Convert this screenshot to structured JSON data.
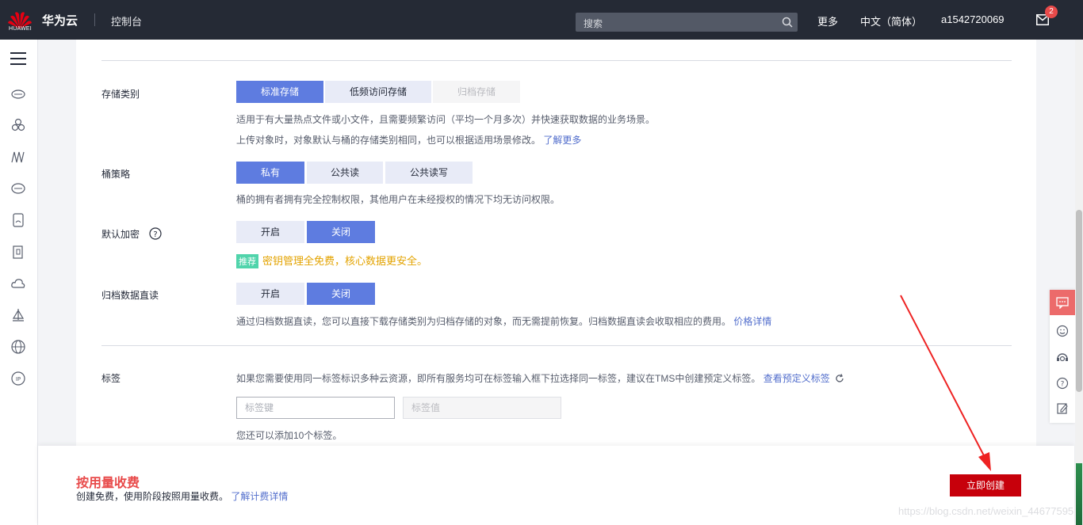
{
  "topbar": {
    "logo_text": "HUAWEI",
    "brand": "华为云",
    "console": "控制台",
    "search_placeholder": "搜索",
    "more": "更多",
    "language": "中文（简体）",
    "username": "a1542720069",
    "mail_count": "2"
  },
  "leftnav": {
    "icons": [
      "menu-icon",
      "cloud-server-icon",
      "cloud-cluster-icon",
      "network-icon",
      "storage-icon",
      "database-icon",
      "container-icon",
      "cloud-icon",
      "ship-icon",
      "globe-icon",
      "ip-icon"
    ]
  },
  "form": {
    "storage_class": {
      "label": "存储类别",
      "options": [
        "标准存储",
        "低频访问存储",
        "归档存储"
      ],
      "selected": "标准存储",
      "desc1": "适用于有大量热点文件或小文件，且需要频繁访问（平均一个月多次）并快速获取数据的业务场景。",
      "desc2": "上传对象时，对象默认与桶的存储类别相同，也可以根据适用场景修改。",
      "desc2_link": "了解更多"
    },
    "bucket_policy": {
      "label": "桶策略",
      "options": [
        "私有",
        "公共读",
        "公共读写"
      ],
      "selected": "私有",
      "desc": "桶的拥有者拥有完全控制权限，其他用户在未经授权的情况下均无访问权限。"
    },
    "default_encryption": {
      "label": "默认加密",
      "options": [
        "开启",
        "关闭"
      ],
      "selected": "关闭",
      "rec_tag": "推荐",
      "rec_text": "密钥管理全免费，核心数据更安全。"
    },
    "archive_direct_read": {
      "label": "归档数据直读",
      "options": [
        "开启",
        "关闭"
      ],
      "selected": "关闭",
      "desc": "通过归档数据直读，您可以直接下载存储类别为归档存储的对象，而无需提前恢复。归档数据直读会收取相应的费用。",
      "desc_link": "价格详情"
    },
    "tags": {
      "label": "标签",
      "desc": "如果您需要使用同一标签标识多种云资源，即所有服务均可在标签输入框下拉选择同一标签，建议在TMS中创建预定义标签。",
      "desc_link": "查看预定义标签",
      "key_placeholder": "标签键",
      "value_placeholder": "标签值",
      "hint": "您还可以添加10个标签。"
    }
  },
  "footer": {
    "fee_title": "按用量收费",
    "fee_desc": "创建免费，使用阶段按照用量收费。",
    "fee_link": "了解计费详情",
    "create_button": "立即创建",
    "watermark": "https://blog.csdn.net/weixin_44677595"
  },
  "colors": {
    "accent": "#5e7ce0",
    "segment_bg": "#e8ebf7",
    "create": "#c7000b",
    "fee": "#e84a4a",
    "recommend_tag": "#50d4ab",
    "recommend_text": "#e3a300",
    "link": "#526ecc",
    "topbar": "#252a35"
  }
}
